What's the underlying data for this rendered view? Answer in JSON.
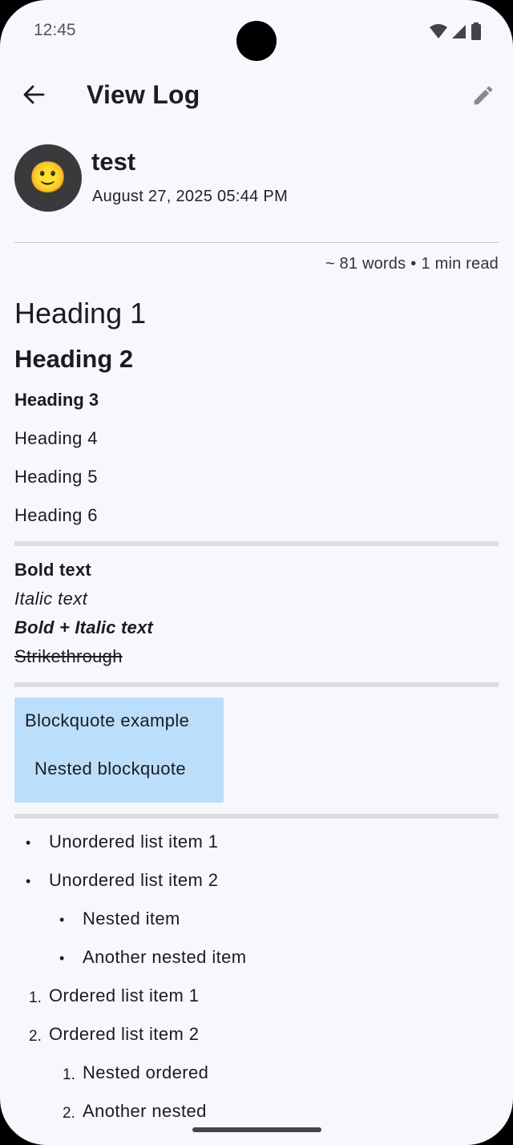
{
  "status_bar": {
    "time": "12:45"
  },
  "app_bar": {
    "title": "View Log"
  },
  "log": {
    "avatar_emoji": "🙂",
    "title": "test",
    "date": "August 27, 2025 05:44 PM",
    "word_count": "~ 81 words",
    "separator": "•",
    "read_time": "1 min read"
  },
  "content": {
    "headings": [
      "Heading 1",
      "Heading 2",
      "Heading 3",
      "Heading 4",
      "Heading 5",
      "Heading 6"
    ],
    "formatting": {
      "bold": "Bold text",
      "italic": "Italic text",
      "bold_italic": "Bold + Italic text",
      "strikethrough": "Strikethrough"
    },
    "blockquote": {
      "text": "Blockquote example",
      "nested": "Nested blockquote"
    },
    "unordered_list": {
      "bullet": "•",
      "items": [
        "Unordered list item 1",
        "Unordered list item 2"
      ],
      "nested_items": [
        "Nested item",
        "Another nested item"
      ]
    },
    "ordered_list": {
      "numbers": [
        "1.",
        "2."
      ],
      "items": [
        "Ordered list item 1",
        "Ordered list item 2"
      ],
      "nested_numbers": [
        "1.",
        "2."
      ],
      "nested_items": [
        "Nested ordered",
        "Another nested"
      ]
    }
  },
  "colors": {
    "background": "#f6f8fd",
    "blockquote_bg": "#bbdefb",
    "avatar_bg": "#3a3a3c"
  }
}
